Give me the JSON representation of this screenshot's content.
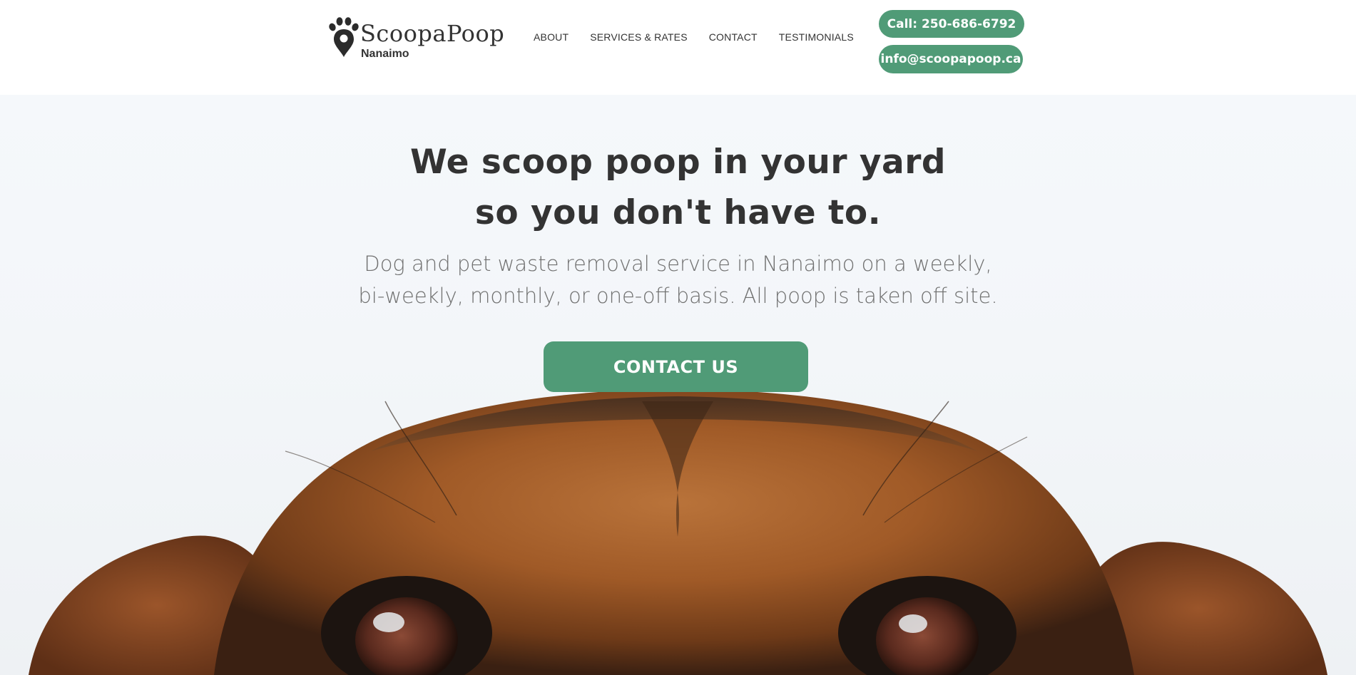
{
  "brand": {
    "name": "ScoopaPoop",
    "location": "Nanaimo",
    "logo_icon": "paw-location-pin-icon"
  },
  "nav": {
    "items": [
      {
        "label": "ABOUT"
      },
      {
        "label": "SERVICES & RATES"
      },
      {
        "label": "CONTACT"
      },
      {
        "label": "TESTIMONIALS"
      }
    ]
  },
  "header_buttons": {
    "phone_label": "Call: 250-686-6792",
    "email_label": "info@scoopapoop.ca"
  },
  "hero": {
    "headline_line1": "We scoop poop in your yard",
    "headline_line2": "so you don't have to.",
    "subtext_line1": "Dog and pet waste removal service in Nanaimo on a weekly,",
    "subtext_line2": "bi-weekly, monthly, or one-off basis. All poop is taken off site.",
    "cta_label": "CONTACT US",
    "background_image": "dog-face-peeking-photo"
  },
  "colors": {
    "accent": "#509b77",
    "text_dark": "#333333",
    "text_muted": "#6f6f6f",
    "hero_bg": "#f3f6f9"
  }
}
